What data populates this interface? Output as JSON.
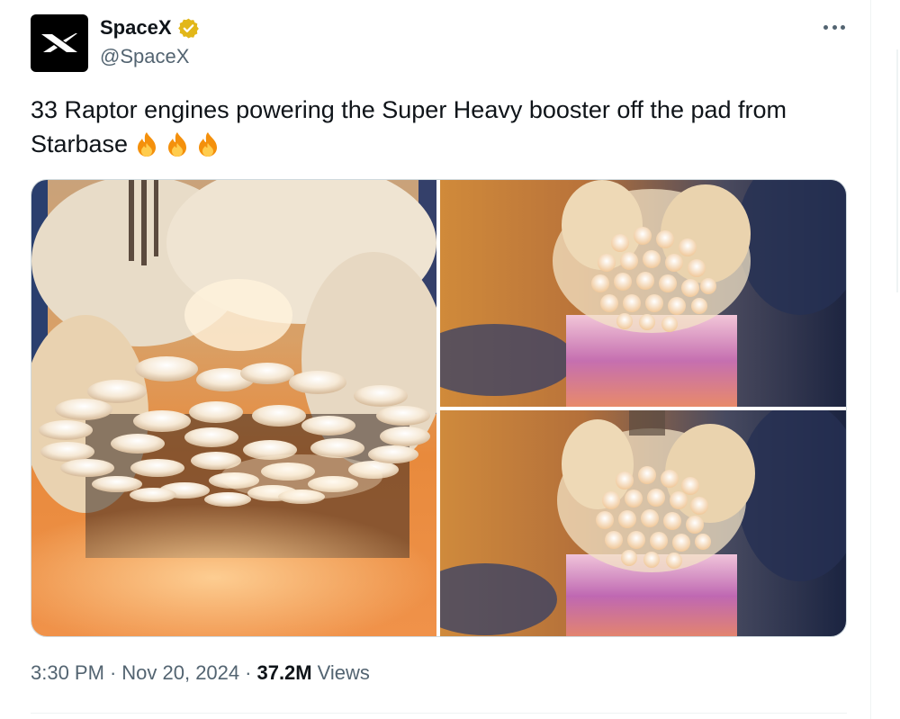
{
  "author": {
    "name": "SpaceX",
    "handle": "@SpaceX",
    "verified": true,
    "avatar_icon": "spacex-x-logo-icon",
    "verified_icon": "verified-badge-icon",
    "verified_color": "#e2b719"
  },
  "tweet": {
    "text_line1": "33 Raptor engines powering the Super Heavy booster off the pad from",
    "text_line2": "Starbase",
    "emoji": [
      "fire-emoji-icon",
      "fire-emoji-icon",
      "fire-emoji-icon"
    ]
  },
  "media": {
    "count": 3,
    "images": [
      {
        "name": "booster-engines-closeup-photo"
      },
      {
        "name": "booster-liftoff-photo-1"
      },
      {
        "name": "booster-liftoff-photo-2"
      }
    ]
  },
  "meta": {
    "time": "3:30 PM",
    "separator": "·",
    "date": "Nov 20, 2024",
    "views_count": "37.2M",
    "views_label": "Views"
  },
  "colors": {
    "text_primary": "#0f1419",
    "text_secondary": "#536471",
    "border": "#cfd9de"
  }
}
